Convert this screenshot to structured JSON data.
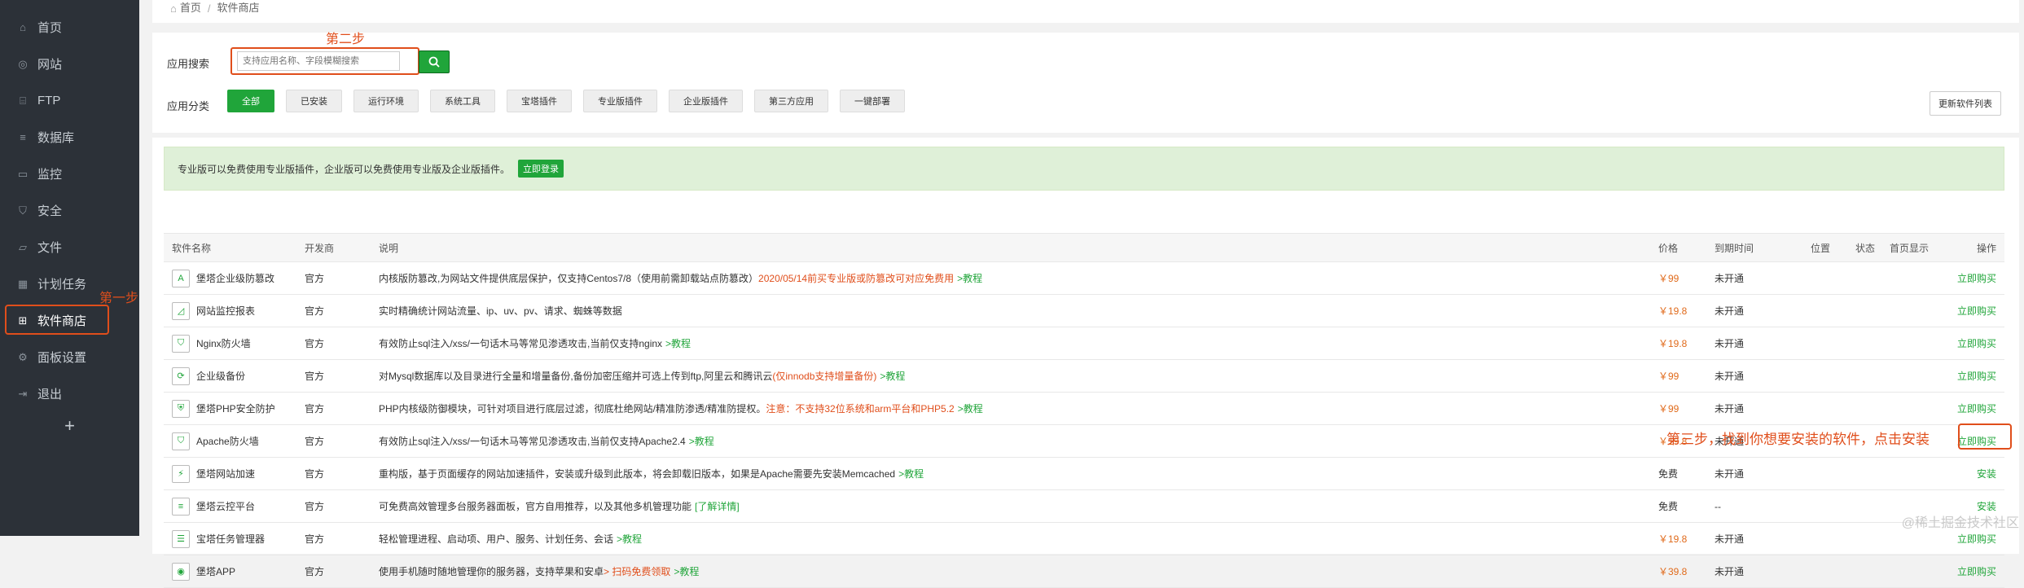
{
  "sidebar": {
    "items": [
      {
        "label": "首页",
        "icon": "home-icon"
      },
      {
        "label": "网站",
        "icon": "globe-icon"
      },
      {
        "label": "FTP",
        "icon": "ftp-icon"
      },
      {
        "label": "数据库",
        "icon": "database-icon"
      },
      {
        "label": "监控",
        "icon": "monitor-icon"
      },
      {
        "label": "安全",
        "icon": "shield-icon"
      },
      {
        "label": "文件",
        "icon": "folder-icon"
      },
      {
        "label": "计划任务",
        "icon": "calendar-icon"
      },
      {
        "label": "软件商店",
        "icon": "apps-icon",
        "active": true
      },
      {
        "label": "面板设置",
        "icon": "gear-icon"
      },
      {
        "label": "退出",
        "icon": "logout-icon"
      }
    ],
    "add": "+"
  },
  "breadcrumb": {
    "home": "首页",
    "sep": "/",
    "current": "软件商店"
  },
  "search": {
    "label": "应用搜索",
    "placeholder": "支持应用名称、字段模糊搜索"
  },
  "categories": {
    "label": "应用分类",
    "items": [
      "全部",
      "已安装",
      "运行环境",
      "系统工具",
      "宝塔插件",
      "专业版插件",
      "企业版插件",
      "第三方应用",
      "一键部署"
    ],
    "update_button": "更新软件列表"
  },
  "banner": {
    "text": "专业版可以免费使用专业版插件，企业版可以免费使用专业版及企业版插件。",
    "login": "立即登录"
  },
  "table": {
    "headers": {
      "name": "软件名称",
      "dev": "开发商",
      "desc": "说明",
      "price": "价格",
      "exp": "到期时间",
      "pos": "位置",
      "status": "状态",
      "home": "首页显示",
      "op": "操作"
    },
    "rows": [
      {
        "name": "堡塔企业级防篡改",
        "dev": "官方",
        "desc": "内核版防篡改,为网站文件提供底层保护，仅支持Centos7/8（使用前需卸载站点防篡改）",
        "desc_red": "2020/05/14前买专业版或防篡改可对应免费用",
        "desc_link": ">教程",
        "price": "￥99",
        "exp": "未开通",
        "op": "立即购买"
      },
      {
        "name": "网站监控报表",
        "dev": "官方",
        "desc": "实时精确统计网站流量、ip、uv、pv、请求、蜘蛛等数据",
        "desc_red": "",
        "desc_link": "",
        "price": "￥19.8",
        "exp": "未开通",
        "op": "立即购买"
      },
      {
        "name": "Nginx防火墙",
        "dev": "官方",
        "desc": "有效防止sql注入/xss/一句话木马等常见渗透攻击,当前仅支持nginx",
        "desc_red": "",
        "desc_link": ">教程",
        "price": "￥19.8",
        "exp": "未开通",
        "op": "立即购买"
      },
      {
        "name": "企业级备份",
        "dev": "官方",
        "desc": "对Mysql数据库以及目录进行全量和增量备份,备份加密压缩并可选上传到ftp,阿里云和腾讯云",
        "desc_red": "(仅innodb支持增量备份)",
        "desc_link": ">教程",
        "price": "￥99",
        "exp": "未开通",
        "op": "立即购买"
      },
      {
        "name": "堡塔PHP安全防护",
        "dev": "官方",
        "desc": "PHP内核级防御模块，可针对项目进行底层过滤，彻底杜绝网站/精准防渗透/精准防提权。",
        "desc_red": "注意：不支持32位系统和arm平台和PHP5.2",
        "desc_link": ">教程",
        "price": "￥99",
        "exp": "未开通",
        "op": "立即购买"
      },
      {
        "name": "Apache防火墙",
        "dev": "官方",
        "desc": "有效防止sql注入/xss/一句话木马等常见渗透攻击,当前仅支持Apache2.4",
        "desc_red": "",
        "desc_link": ">教程",
        "price": "￥19.8",
        "exp": "未开通",
        "op": "立即购买"
      },
      {
        "name": "堡塔网站加速",
        "dev": "官方",
        "desc": "重构版，基于页面缓存的网站加速插件，安装或升级到此版本，将会卸载旧版本，如果是Apache需要先安装Memcached",
        "desc_red": "",
        "desc_link": ">教程",
        "price": "免费",
        "exp": "未开通",
        "op": "安装"
      },
      {
        "name": "堡塔云控平台",
        "dev": "官方",
        "desc": "可免费高效管理多台服务器面板，官方自用推荐，以及其他多机管理功能",
        "desc_red": "",
        "desc_link": "[了解详情]",
        "price": "免费",
        "exp": "--",
        "op": "安装"
      },
      {
        "name": "宝塔任务管理器",
        "dev": "官方",
        "desc": "轻松管理进程、启动项、用户、服务、计划任务、会话",
        "desc_red": "",
        "desc_link": ">教程",
        "price": "￥19.8",
        "exp": "未开通",
        "op": "立即购买"
      },
      {
        "name": "堡塔APP",
        "dev": "官方",
        "desc": "使用手机随时随地管理你的服务器，支持苹果和安卓",
        "desc_red": "> 扫码免费领取",
        "desc_link": ">教程",
        "price": "￥39.8",
        "exp": "未开通",
        "op": "立即购买"
      }
    ]
  },
  "annotations": {
    "step1": "第一步",
    "step2": "第二步",
    "step3": "第三步，找到你想要安装的软件，点击安装"
  },
  "watermark": "@稀土掘金技术社区",
  "colors": {
    "sidebar": "#2c3138",
    "accent": "#20a53a",
    "annotation": "#e04e1b"
  }
}
